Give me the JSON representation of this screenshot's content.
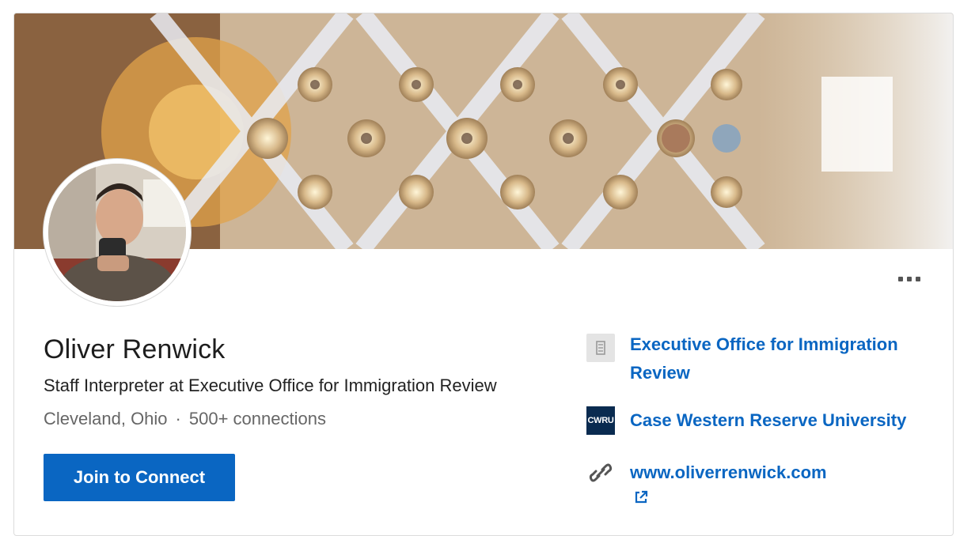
{
  "profile": {
    "name": "Oliver Renwick",
    "headline": "Staff Interpreter at Executive Office for Immigration Review",
    "location": "Cleveland, Ohio",
    "separator": "·",
    "connections": "500+ connections",
    "join_label": "Join to Connect"
  },
  "sidebar": {
    "company": {
      "label": "Executive Office for Immigration Review",
      "icon": "building-icon"
    },
    "school": {
      "label": "Case Western Reserve University",
      "logo_text": "CWRU",
      "icon": "school-logo"
    },
    "website": {
      "label": "www.oliverrenwick.com",
      "icon": "link-icon",
      "external_icon": "external-link-icon"
    }
  },
  "colors": {
    "accent": "#0a66c2",
    "text_primary": "#1d1d1d",
    "text_secondary": "#666666",
    "school_logo_bg": "#0a2b50"
  }
}
